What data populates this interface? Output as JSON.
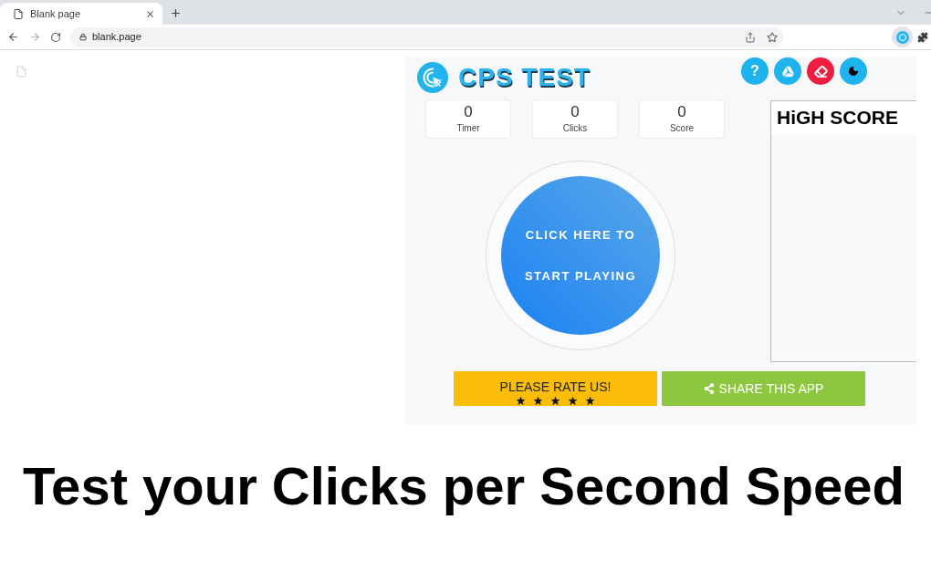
{
  "browser": {
    "tab": {
      "title": "Blank page"
    },
    "address": "blank.page"
  },
  "app": {
    "title": "CPS TEST",
    "toolbar": [
      {
        "kind": "help",
        "label": "?"
      },
      {
        "kind": "drive"
      },
      {
        "kind": "eraser"
      },
      {
        "kind": "theme"
      }
    ],
    "stats": [
      {
        "value": "0",
        "label": "Timer"
      },
      {
        "value": "0",
        "label": "Clicks"
      },
      {
        "value": "0",
        "label": "Score"
      }
    ],
    "start_button": {
      "lines": [
        "CLICK HERE TO",
        "START PLAYING"
      ]
    },
    "high_score": {
      "title": "HiGH SCORE"
    },
    "rate_button": {
      "label": "PLEASE RATE US!",
      "stars": 5
    },
    "share_button": {
      "label": "SHARE THIS APP"
    }
  },
  "caption": "Test your Clicks per Second Speed"
}
